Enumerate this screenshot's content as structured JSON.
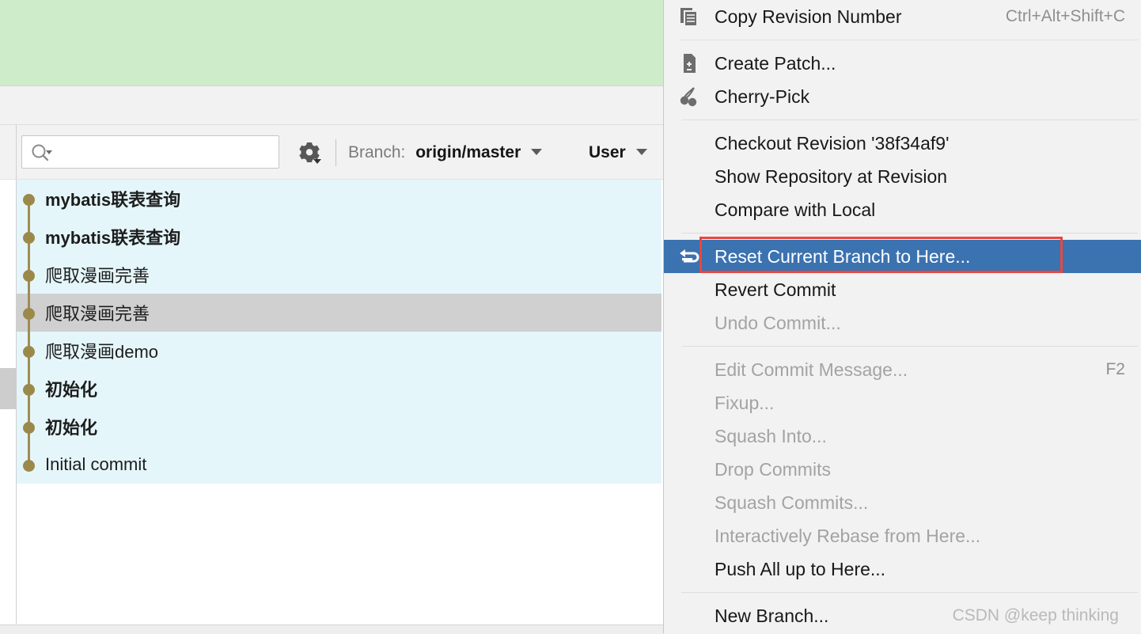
{
  "toolbar": {
    "search_placeholder": "",
    "search_value": "",
    "search_icon": "search-icon",
    "gear_icon": "gear-icon",
    "branch_prefix": "Branch:",
    "branch_value": "origin/master",
    "user_label": "User"
  },
  "commit_list": {
    "rows": [
      {
        "subject": "mybatis联表查询",
        "bold": true,
        "selected": false
      },
      {
        "subject": "mybatis联表查询",
        "bold": true,
        "selected": false
      },
      {
        "subject": "爬取漫画完善",
        "bold": false,
        "selected": false
      },
      {
        "subject": "爬取漫画完善",
        "bold": false,
        "selected": true
      },
      {
        "subject": "爬取漫画demo",
        "bold": false,
        "selected": false
      },
      {
        "subject": "初始化",
        "bold": true,
        "selected": false
      },
      {
        "subject": "初始化",
        "bold": true,
        "selected": false
      },
      {
        "subject": "Initial commit",
        "bold": false,
        "selected": false
      }
    ]
  },
  "context_menu": {
    "items": [
      {
        "label": "Copy Revision Number",
        "shortcut": "Ctrl+Alt+Shift+C",
        "icon": "copy-icon",
        "disabled": false,
        "highlighted": false,
        "separator_after": true
      },
      {
        "label": "Create Patch...",
        "shortcut": "",
        "icon": "patch-icon",
        "disabled": false,
        "highlighted": false,
        "separator_after": false
      },
      {
        "label": "Cherry-Pick",
        "shortcut": "",
        "icon": "cherry-icon",
        "disabled": false,
        "highlighted": false,
        "separator_after": true
      },
      {
        "label": "Checkout Revision '38f34af9'",
        "shortcut": "",
        "icon": "",
        "disabled": false,
        "highlighted": false,
        "separator_after": false
      },
      {
        "label": "Show Repository at Revision",
        "shortcut": "",
        "icon": "",
        "disabled": false,
        "highlighted": false,
        "separator_after": false
      },
      {
        "label": "Compare with Local",
        "shortcut": "",
        "icon": "",
        "disabled": false,
        "highlighted": false,
        "separator_after": true
      },
      {
        "label": "Reset Current Branch to Here...",
        "shortcut": "",
        "icon": "reset-icon",
        "disabled": false,
        "highlighted": true,
        "separator_after": false
      },
      {
        "label": "Revert Commit",
        "shortcut": "",
        "icon": "",
        "disabled": false,
        "highlighted": false,
        "separator_after": false
      },
      {
        "label": "Undo Commit...",
        "shortcut": "",
        "icon": "",
        "disabled": true,
        "highlighted": false,
        "separator_after": true
      },
      {
        "label": "Edit Commit Message...",
        "shortcut": "F2",
        "icon": "",
        "disabled": true,
        "highlighted": false,
        "separator_after": false
      },
      {
        "label": "Fixup...",
        "shortcut": "",
        "icon": "",
        "disabled": true,
        "highlighted": false,
        "separator_after": false
      },
      {
        "label": "Squash Into...",
        "shortcut": "",
        "icon": "",
        "disabled": true,
        "highlighted": false,
        "separator_after": false
      },
      {
        "label": "Drop Commits",
        "shortcut": "",
        "icon": "",
        "disabled": true,
        "highlighted": false,
        "separator_after": false
      },
      {
        "label": "Squash Commits...",
        "shortcut": "",
        "icon": "",
        "disabled": true,
        "highlighted": false,
        "separator_after": false
      },
      {
        "label": "Interactively Rebase from Here...",
        "shortcut": "",
        "icon": "",
        "disabled": true,
        "highlighted": false,
        "separator_after": false
      },
      {
        "label": "Push All up to Here...",
        "shortcut": "",
        "icon": "",
        "disabled": false,
        "highlighted": false,
        "separator_after": true
      },
      {
        "label": "New Branch...",
        "shortcut": "",
        "icon": "",
        "disabled": false,
        "highlighted": false,
        "separator_after": false
      }
    ]
  },
  "annotation": {
    "color": "#e8473f"
  },
  "watermark": {
    "text": "CSDN @keep   thinking"
  },
  "colors": {
    "banner_green": "#cfecca",
    "row_background": "#e5f6fb",
    "row_selected": "#d0d0d0",
    "menu_highlight": "#3b72b0",
    "graph_node": "#9b8949"
  }
}
